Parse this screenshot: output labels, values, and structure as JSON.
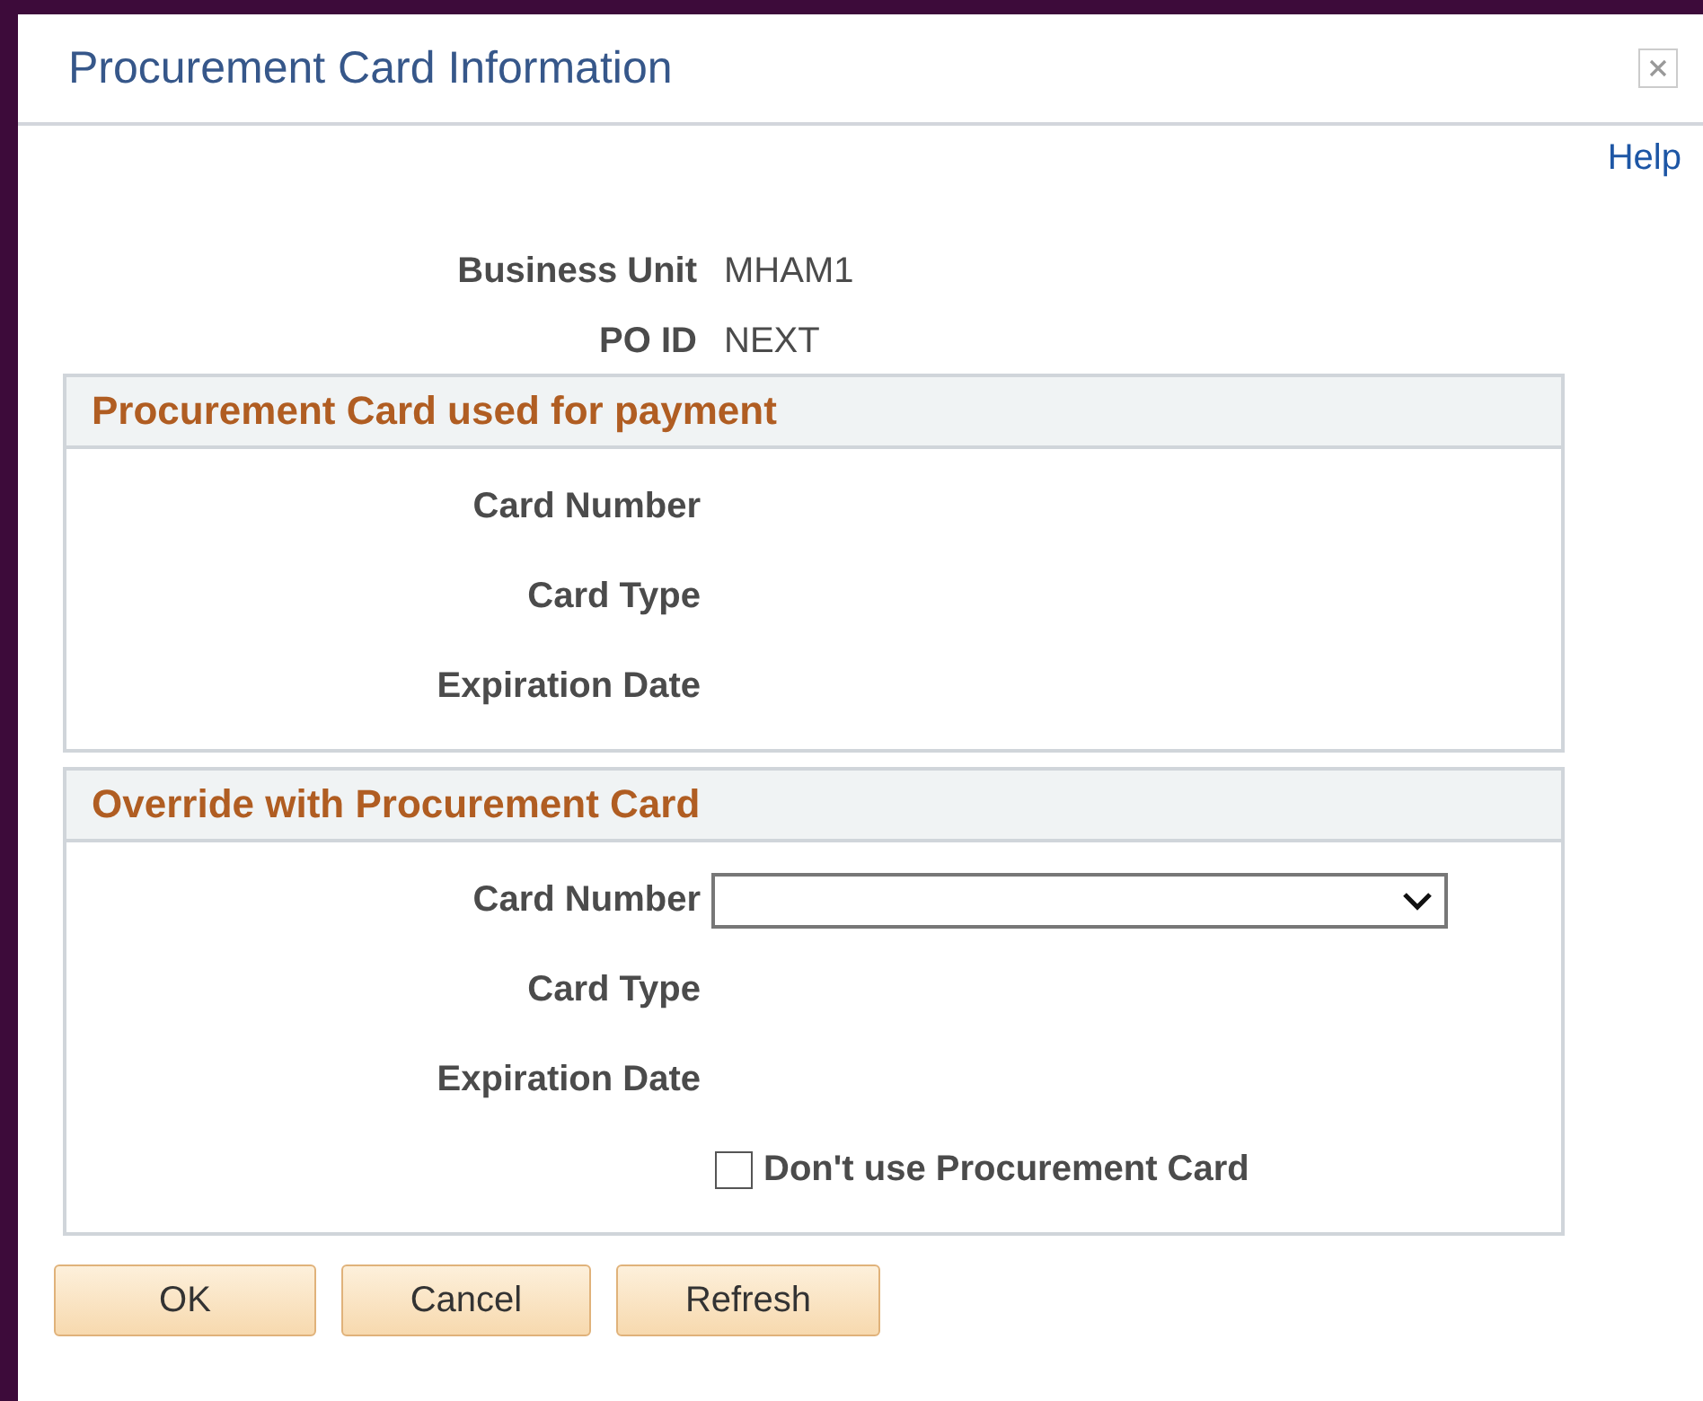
{
  "window": {
    "title": "Procurement Card Information"
  },
  "help_link": "Help",
  "header_fields": [
    {
      "label": "Business Unit",
      "value": "MHAM1"
    },
    {
      "label": "PO ID",
      "value": "NEXT"
    }
  ],
  "sections": [
    {
      "title": "Procurement Card used for payment",
      "fields": [
        {
          "kind": "display",
          "label": "Card Number"
        },
        {
          "kind": "display",
          "label": "Card Type"
        },
        {
          "kind": "display",
          "label": "Expiration Date"
        }
      ]
    },
    {
      "title": "Override with Procurement Card",
      "fields": [
        {
          "kind": "dropdown",
          "label": "Card Number"
        },
        {
          "kind": "display",
          "label": "Card Type"
        },
        {
          "kind": "display",
          "label": "Expiration Date"
        },
        {
          "kind": "checkbox",
          "label": "Don't use Procurement Card",
          "checked": false
        }
      ]
    }
  ],
  "buttons": [
    "OK",
    "Cancel",
    "Refresh"
  ]
}
